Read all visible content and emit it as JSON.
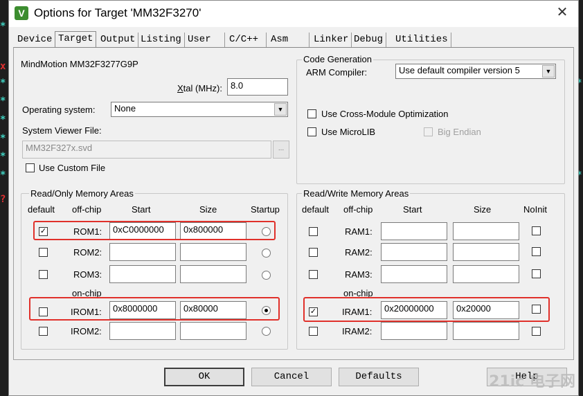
{
  "window": {
    "title": "Options for Target 'MM32F3270'",
    "icon_letter": "V",
    "close": "✕"
  },
  "tabs": [
    {
      "label": "Device",
      "ul": ""
    },
    {
      "label": "Target",
      "ul": ""
    },
    {
      "label": "Output",
      "ul": ""
    },
    {
      "label": "Listing",
      "ul": ""
    },
    {
      "label": "User",
      "ul": ""
    },
    {
      "label": "C/C++",
      "ul": ""
    },
    {
      "label": "Asm",
      "ul": ""
    },
    {
      "label": "Linker",
      "ul": ""
    },
    {
      "label": "Debug",
      "ul": ""
    },
    {
      "label": "Utilities",
      "ul": ""
    }
  ],
  "device_name": "MindMotion MM32F3277G9P",
  "xtal": {
    "label_pre": "X",
    "label_post": "tal (MHz):",
    "value": "8.0"
  },
  "os": {
    "label": "Operating system:",
    "value": "None"
  },
  "svd": {
    "label": "System Viewer File:",
    "value": "MM32F327x.svd",
    "browse": "..."
  },
  "custom_file": {
    "label": "Use Custom File",
    "checked": ""
  },
  "codegen": {
    "title": "Code Generation",
    "compiler_label": "ARM Compiler:",
    "compiler_value": "Use default compiler version 5",
    "cross_module": "Use Cross-Module Optimization",
    "microlib": "Use MicroLIB",
    "big_endian": "Big Endian"
  },
  "ro": {
    "title": "Read/Only Memory Areas",
    "headers": {
      "default": "default",
      "offchip": "off-chip",
      "start": "Start",
      "size": "Size",
      "startup": "Startup"
    },
    "onchip_label": "on-chip",
    "rows": [
      {
        "name": "ROM1:",
        "start": "0xC0000000",
        "size": "0x800000",
        "checked": "✓"
      },
      {
        "name": "ROM2:",
        "start": "",
        "size": "",
        "checked": ""
      },
      {
        "name": "ROM3:",
        "start": "",
        "size": "",
        "checked": ""
      },
      {
        "name": "IROM1:",
        "start": "0x8000000",
        "size": "0x80000",
        "checked": ""
      },
      {
        "name": "IROM2:",
        "start": "",
        "size": "",
        "checked": ""
      }
    ]
  },
  "rw": {
    "title": "Read/Write Memory Areas",
    "headers": {
      "default": "default",
      "offchip": "off-chip",
      "start": "Start",
      "size": "Size",
      "noinit": "NoInit"
    },
    "onchip_label": "on-chip",
    "rows": [
      {
        "name": "RAM1:",
        "start": "",
        "size": "",
        "checked": ""
      },
      {
        "name": "RAM2:",
        "start": "",
        "size": "",
        "checked": ""
      },
      {
        "name": "RAM3:",
        "start": "",
        "size": "",
        "checked": ""
      },
      {
        "name": "IRAM1:",
        "start": "0x20000000",
        "size": "0x20000",
        "checked": "✓"
      },
      {
        "name": "IRAM2:",
        "start": "",
        "size": "",
        "checked": ""
      }
    ]
  },
  "buttons": {
    "ok": "OK",
    "cancel": "Cancel",
    "defaults": "Defaults",
    "help": "Help"
  },
  "watermark": "21ic 电子网"
}
